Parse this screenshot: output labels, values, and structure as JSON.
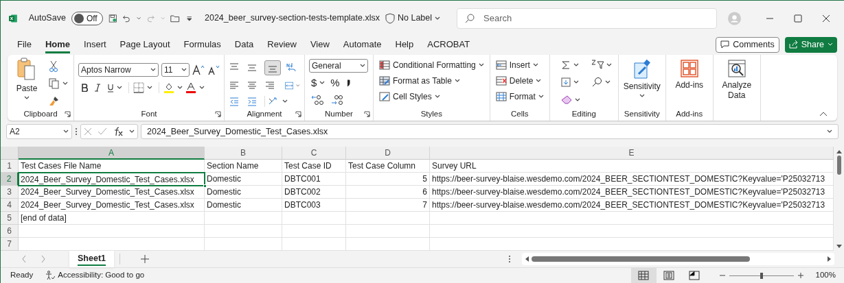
{
  "title_bar": {
    "autosave_label": "AutoSave",
    "autosave": {
      "on": false,
      "label": "Off"
    },
    "file_name": "2024_beer_survey-section-tests-template.xlsx",
    "sensitivity": "No Label",
    "search": {
      "placeholder": "Search"
    }
  },
  "tabs": [
    {
      "label": "File",
      "selected": false
    },
    {
      "label": "Home",
      "selected": true
    },
    {
      "label": "Insert",
      "selected": false
    },
    {
      "label": "Page Layout",
      "selected": false
    },
    {
      "label": "Formulas",
      "selected": false
    },
    {
      "label": "Data",
      "selected": false
    },
    {
      "label": "Review",
      "selected": false
    },
    {
      "label": "View",
      "selected": false
    },
    {
      "label": "Automate",
      "selected": false
    },
    {
      "label": "Help",
      "selected": false
    },
    {
      "label": "ACROBAT",
      "selected": false
    }
  ],
  "comments_button": "Comments",
  "share_button": "Share",
  "ribbon": {
    "clipboard": {
      "paste": "Paste",
      "group": "Clipboard"
    },
    "font": {
      "font_name": "Aptos Narrow",
      "font_size": "11",
      "group": "Font"
    },
    "alignment": {
      "bottom_align_selected": true,
      "group": "Alignment"
    },
    "number": {
      "format": "General",
      "currency": "$",
      "percent": "%",
      "group": "Number"
    },
    "styles": {
      "items": [
        "Conditional Formatting",
        "Format as Table",
        "Cell Styles"
      ],
      "group": "Styles"
    },
    "cells": {
      "items": [
        "Insert",
        "Delete",
        "Format"
      ],
      "group": "Cells"
    },
    "editing": {
      "group": "Editing"
    },
    "sensitivity": {
      "button": "Sensitivity",
      "group": "Sensitivity"
    },
    "addins": {
      "button": "Add-ins",
      "group": "Add-ins"
    },
    "analyze": {
      "button": "Analyze Data"
    }
  },
  "name_box": "A2",
  "formula": "2024_Beer_Survey_Domestic_Test_Cases.xlsx",
  "sheet": {
    "columns": [
      {
        "label": "A",
        "selected": true
      },
      {
        "label": "B",
        "selected": false
      },
      {
        "label": "C",
        "selected": false
      },
      {
        "label": "D",
        "selected": false
      },
      {
        "label": "E",
        "selected": false
      }
    ],
    "rows": [
      {
        "number": "1",
        "selected": false,
        "kind": "header",
        "cells": [
          "Test Cases File Name",
          "Section Name",
          "Test Case ID",
          "Test Case Column",
          "Survey URL"
        ]
      },
      {
        "number": "2",
        "selected": true,
        "kind": "data",
        "cells": [
          "2024_Beer_Survey_Domestic_Test_Cases.xlsx",
          "Domestic",
          "DBTC001",
          "5",
          "https://beer-survey-blaise.wesdemo.com/2024_BEER_SECTIONTEST_DOMESTIC?Keyvalue='P25032713"
        ]
      },
      {
        "number": "3",
        "selected": false,
        "kind": "data",
        "cells": [
          "2024_Beer_Survey_Domestic_Test_Cases.xlsx",
          "Domestic",
          "DBTC002",
          "6",
          "https://beer-survey-blaise.wesdemo.com/2024_BEER_SECTIONTEST_DOMESTIC?Keyvalue='P25032713"
        ]
      },
      {
        "number": "4",
        "selected": false,
        "kind": "data",
        "cells": [
          "2024_Beer_Survey_Domestic_Test_Cases.xlsx",
          "Domestic",
          "DBTC003",
          "7",
          "https://beer-survey-blaise.wesdemo.com/2024_BEER_SECTIONTEST_DOMESTIC?Keyvalue='P25032713"
        ]
      },
      {
        "number": "5",
        "selected": false,
        "kind": "data",
        "cells": [
          "[end of data]"
        ]
      },
      {
        "number": "6",
        "selected": false,
        "kind": "data"
      },
      {
        "number": "7",
        "selected": false,
        "kind": "data"
      }
    ]
  },
  "sheet_tabs": [
    {
      "label": "Sheet1",
      "selected": true
    }
  ],
  "status_bar": {
    "status": "Ready",
    "accessibility": "Accessibility: Good to go",
    "views": [
      {
        "kind": "normal",
        "selected": true
      },
      {
        "kind": "page_layout",
        "selected": false
      },
      {
        "kind": "page_break",
        "selected": false
      }
    ],
    "zoom": {
      "level": 0.5,
      "label": "100%"
    }
  }
}
